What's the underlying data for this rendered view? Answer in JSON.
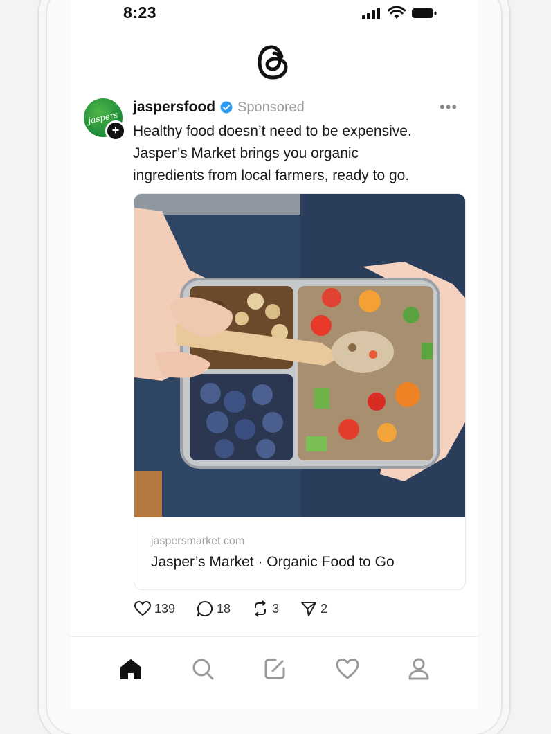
{
  "status_bar": {
    "time": "8:23"
  },
  "post": {
    "username": "jaspersfood",
    "sponsored_label": "Sponsored",
    "avatar_text": "jaspers",
    "text_lines": [
      "Healthy food doesn’t need to be expensive.",
      "Jasper’s Market brings you organic",
      "ingredients from local farmers, ready to go."
    ],
    "link": {
      "domain": "jaspersmarket.com",
      "title": "Jasper’s Market · Organic Food to Go"
    },
    "counts": {
      "likes": "139",
      "replies": "18",
      "reposts": "3",
      "shares": "2"
    }
  },
  "icons": {
    "app": "threads-logo-icon",
    "tabs": [
      "home-icon",
      "search-icon",
      "compose-icon",
      "heart-icon",
      "profile-icon"
    ],
    "actions": [
      "heart-icon",
      "reply-bubble-icon",
      "repost-icon",
      "send-icon"
    ]
  },
  "colors": {
    "verified": "#2d9bf0",
    "brand_green": "#2f9e3f"
  }
}
